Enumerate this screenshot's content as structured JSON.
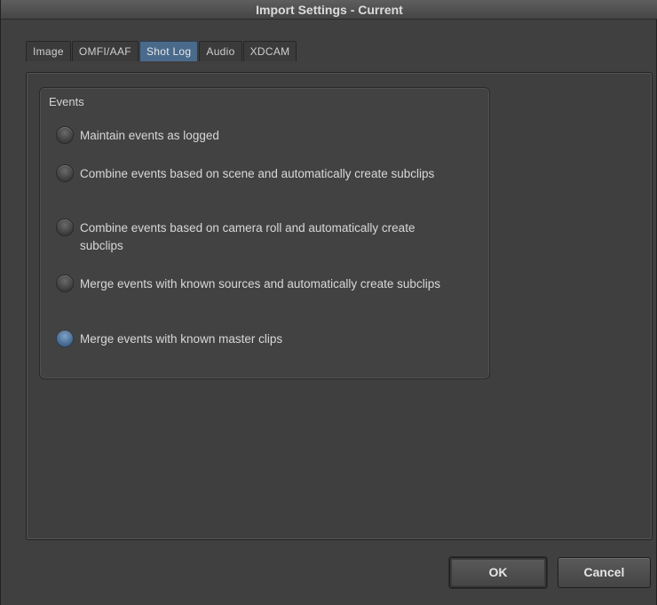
{
  "window": {
    "title": "Import Settings - Current"
  },
  "tabs": [
    {
      "label": "Image",
      "active": false
    },
    {
      "label": "OMFI/AAF",
      "active": false
    },
    {
      "label": "Shot Log",
      "active": true
    },
    {
      "label": "Audio",
      "active": false
    },
    {
      "label": "XDCAM",
      "active": false
    }
  ],
  "events": {
    "title": "Events",
    "options": [
      {
        "label": "Maintain events as logged",
        "checked": false
      },
      {
        "label": "Combine events based on scene and automatically create subclips",
        "checked": false
      },
      {
        "label": "Combine events based on camera roll and automatically create subclips",
        "checked": false
      },
      {
        "label": "Merge events with known sources and automatically create subclips",
        "checked": false
      },
      {
        "label": "Merge events with known master clips",
        "checked": true
      }
    ]
  },
  "buttons": {
    "ok": "OK",
    "cancel": "Cancel"
  },
  "colors": {
    "accent": "#4a6a8c",
    "background": "#404040"
  }
}
